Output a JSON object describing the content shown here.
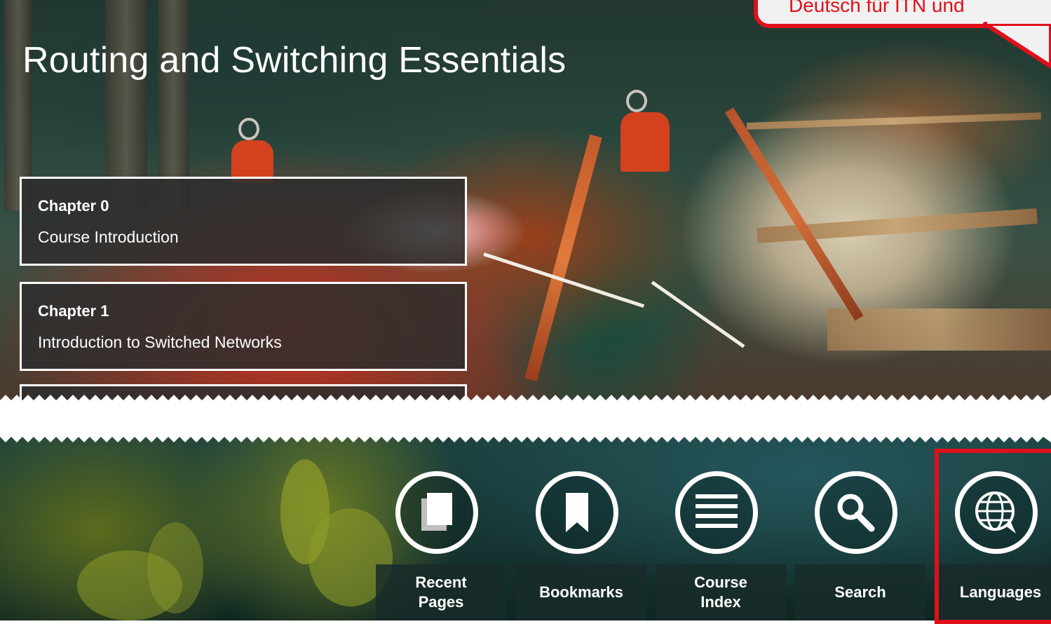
{
  "header": {
    "title": "Routing and Switching Essentials"
  },
  "chapters": [
    {
      "number": "Chapter 0",
      "title": "Course Introduction"
    },
    {
      "number": "Chapter 1",
      "title": "Introduction to Switched Networks"
    }
  ],
  "callout": {
    "text": "Deutsch für ITN und",
    "color": "#e0101a"
  },
  "nav": {
    "items": [
      {
        "label": "Recent\nPages",
        "icon": "pages-icon"
      },
      {
        "label": "Bookmarks",
        "icon": "bookmark-icon"
      },
      {
        "label": "Course\nIndex",
        "icon": "list-icon"
      },
      {
        "label": "Search",
        "icon": "search-icon"
      },
      {
        "label": "Languages",
        "icon": "globe-icon",
        "highlighted": true
      }
    ]
  },
  "colors": {
    "highlight": "#e0101a",
    "card_bg": "#2d2d2d",
    "text": "#ffffff"
  }
}
